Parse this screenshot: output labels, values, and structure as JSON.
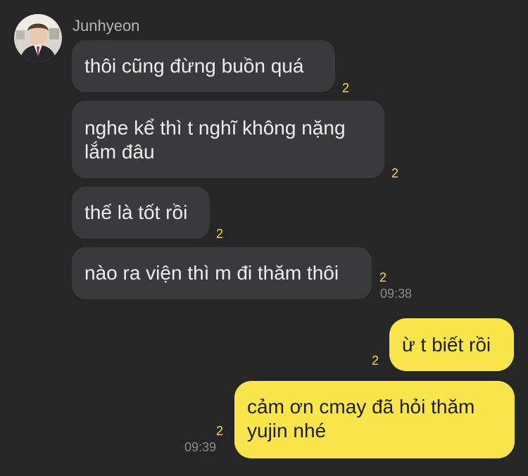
{
  "contact": {
    "name": "Junhyeon",
    "avatar_icon": "profile-photo"
  },
  "messages": [
    {
      "from": "contact",
      "text": "thôi cũng đừng buồn quá",
      "unread": "2"
    },
    {
      "from": "contact",
      "text": "nghe kể thì t nghĩ không nặng lắm đâu",
      "unread": "2"
    },
    {
      "from": "contact",
      "text": "thế là tốt rồi",
      "unread": "2"
    },
    {
      "from": "contact",
      "text": "nào ra viện thì m đi thăm thôi",
      "unread": "2",
      "time": "09:38"
    },
    {
      "from": "me",
      "text": "ừ t biết rồi",
      "unread": "2"
    },
    {
      "from": "me",
      "text": "cảm ơn cmay đã hỏi thăm yujin nhé",
      "unread": "2",
      "time": "09:39"
    }
  ],
  "colors": {
    "background": "#262626",
    "incoming_bubble": "#3a3a3c",
    "outgoing_bubble": "#fbe54d",
    "unread_count": "#f7d84a"
  }
}
